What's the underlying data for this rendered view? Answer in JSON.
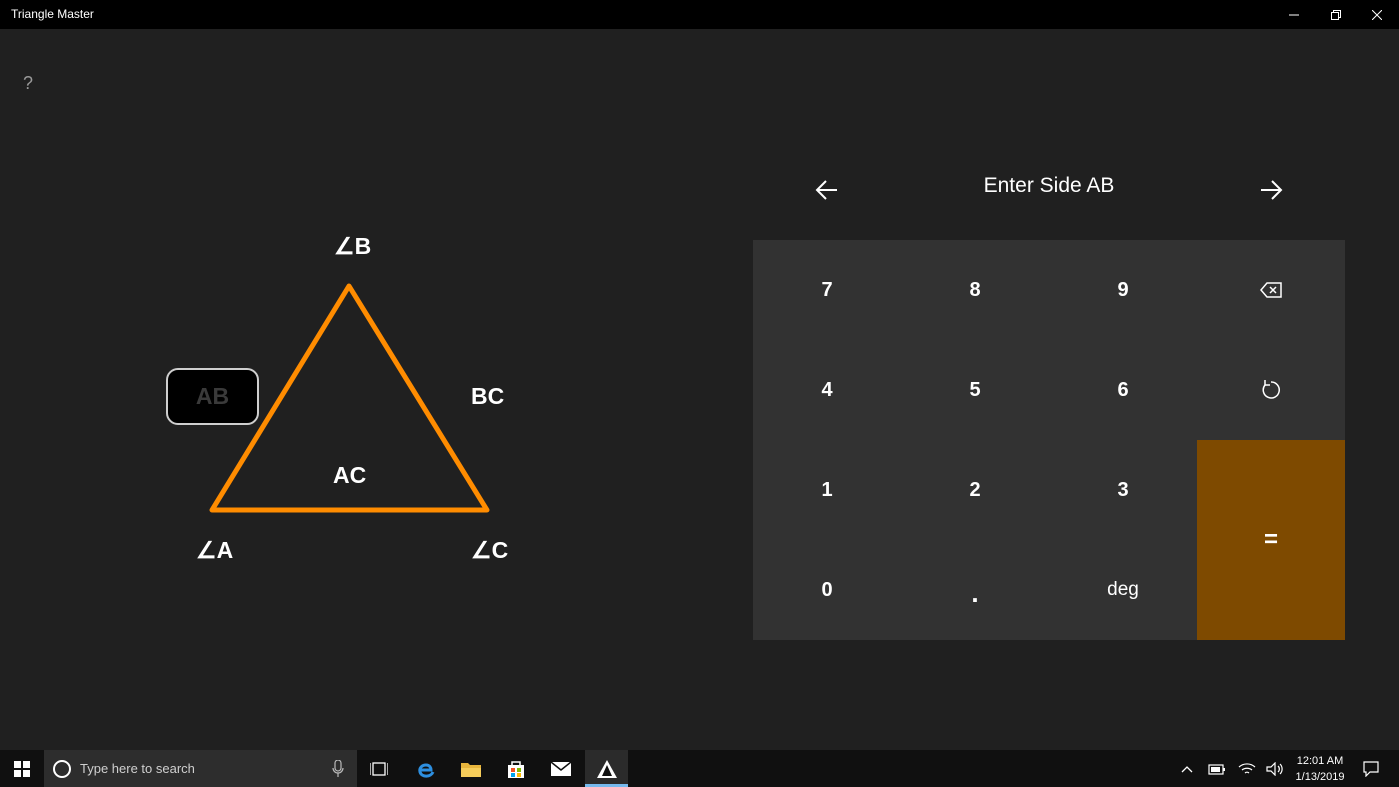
{
  "window": {
    "title": "Triangle Master"
  },
  "help": {
    "label": "?"
  },
  "triangle": {
    "angle_b": "∠B",
    "angle_a": "∠A",
    "angle_c": "∠C",
    "side_ab": "AB",
    "side_bc": "BC",
    "side_ac": "AC",
    "colors": {
      "stroke": "#ff8c00",
      "selected_side_bg": "#000000"
    },
    "selected_side": "AB"
  },
  "input": {
    "prompt": "Enter Side AB",
    "prev_icon": "arrow-left-icon",
    "next_icon": "arrow-right-icon"
  },
  "keypad": {
    "k7": "7",
    "k8": "8",
    "k9": "9",
    "k4": "4",
    "k5": "5",
    "k6": "6",
    "k1": "1",
    "k2": "2",
    "k3": "3",
    "k0": "0",
    "dot": ".",
    "deg": "deg",
    "equals": "=",
    "backspace_icon": "backspace-icon",
    "reset_icon": "refresh-icon",
    "colors": {
      "equals_bg": "#7e4a00",
      "pad_bg": "#323232"
    }
  },
  "taskbar": {
    "search_placeholder": "Type here to search",
    "time": "12:01 AM",
    "date": "1/13/2019",
    "accent": "#76b9ed"
  }
}
